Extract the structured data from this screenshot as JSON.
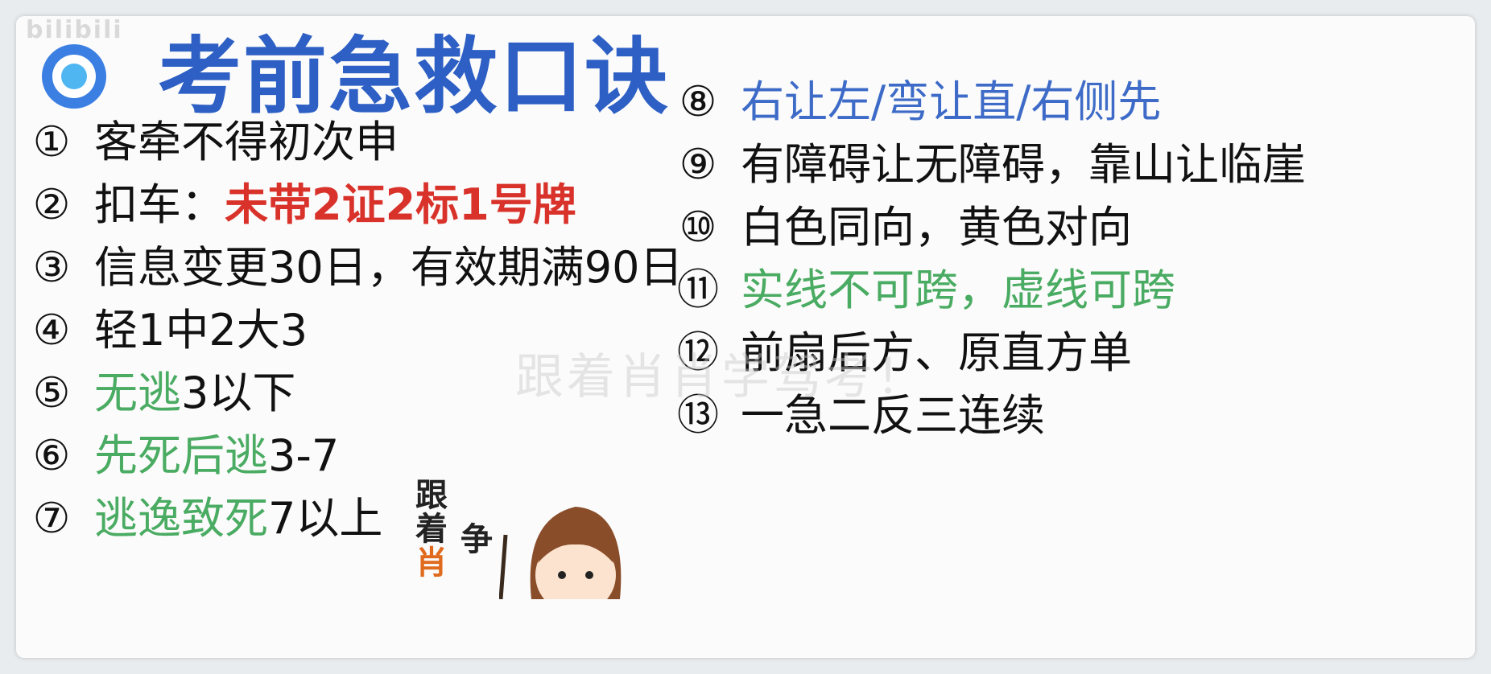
{
  "corner_watermark": "bilibili",
  "title": "考前急救口诀",
  "icon": "target-icon",
  "colors": {
    "title": "#2d5fc4",
    "red": "#d8322a",
    "green": "#4aab62",
    "blue": "#3d6bc7",
    "text": "#111111"
  },
  "left_rules": [
    {
      "num": "①",
      "parts": [
        {
          "text": "客牵不得初次申",
          "color": "plain"
        }
      ]
    },
    {
      "num": "②",
      "parts": [
        {
          "text": "扣车：",
          "color": "plain"
        },
        {
          "text": "未带2证2标1号牌",
          "color": "red"
        }
      ]
    },
    {
      "num": "③",
      "parts": [
        {
          "text": "信息变更30日，有效期满90日",
          "color": "plain"
        }
      ]
    },
    {
      "num": "④",
      "parts": [
        {
          "text": "轻1中2大3",
          "color": "plain"
        }
      ]
    },
    {
      "num": "⑤",
      "parts": [
        {
          "text": "无逃",
          "color": "green"
        },
        {
          "text": "3以下",
          "color": "plain"
        }
      ]
    },
    {
      "num": "⑥",
      "parts": [
        {
          "text": "先死后逃",
          "color": "green"
        },
        {
          "text": "3-7",
          "color": "plain"
        }
      ]
    },
    {
      "num": "⑦",
      "parts": [
        {
          "text": "逃逸致死",
          "color": "green"
        },
        {
          "text": "7以上",
          "color": "plain"
        }
      ]
    }
  ],
  "right_rules": [
    {
      "num": "⑧",
      "parts": [
        {
          "text": "右让左/弯让直/右侧先",
          "color": "blue"
        }
      ]
    },
    {
      "num": "⑨",
      "parts": [
        {
          "text": "有障碍让无障碍，靠山让临崖",
          "color": "plain"
        }
      ]
    },
    {
      "num": "⑩",
      "parts": [
        {
          "text": "白色同向，黄色对向",
          "color": "plain"
        }
      ]
    },
    {
      "num": "⑪",
      "parts": [
        {
          "text": "实线不可跨，虚线可跨",
          "color": "green"
        }
      ]
    },
    {
      "num": "⑫",
      "parts": [
        {
          "text": "前扇后方、原直方单",
          "color": "plain"
        }
      ]
    },
    {
      "num": "⑬",
      "parts": [
        {
          "text": "一急二反三连续",
          "color": "plain"
        }
      ]
    }
  ],
  "center_watermark": "跟着肖肖学驾考！",
  "mascot_text_left": [
    "跟",
    "着",
    "肖"
  ],
  "mascot_text_right": [
    "争"
  ]
}
